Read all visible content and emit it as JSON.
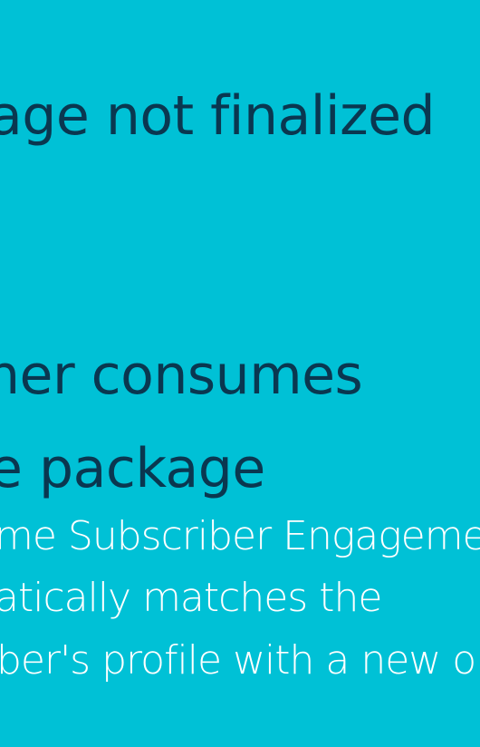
{
  "slide": {
    "lines": [
      "age not finalized",
      "ner consumes",
      "e package",
      "me Subscriber Engageme",
      "atically matches the",
      "ber's profile with a new o"
    ]
  },
  "colors": {
    "background": "#00c1d6",
    "heading": "#0a3750",
    "body": "#ffffff"
  }
}
